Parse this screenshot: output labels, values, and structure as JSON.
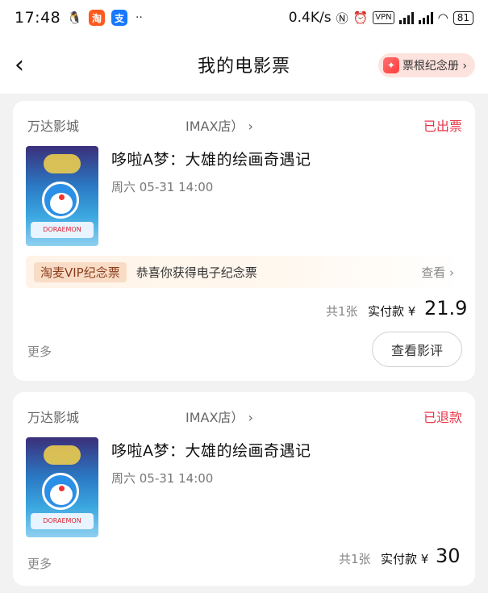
{
  "statusbar": {
    "time": "17:48",
    "speed": "0.4K/s",
    "vpn": "VPN",
    "battery": "81",
    "dots": "··"
  },
  "nav": {
    "title": "我的电影票",
    "stub_button": "票根纪念册 ›"
  },
  "tickets": [
    {
      "cinema": "万达影城",
      "branch": "IMAX店）  ›",
      "status": "已出票",
      "movie": "哆啦A梦：大雄的绘画奇遇记",
      "showtime": "周六 05-31 14:00",
      "vip_tag": "淘麦VIP纪念票",
      "vip_message": "恭喜你获得电子纪念票",
      "vip_view": "查看 ›",
      "count": "共1张",
      "pay_label": "实付款 ¥",
      "price": "21.9",
      "more": "更多",
      "review_button": "查看影评"
    },
    {
      "cinema": "万达影城",
      "branch": "IMAX店）  ›",
      "status": "已退款",
      "movie": "哆啦A梦：大雄的绘画奇遇记",
      "showtime": "周六 05-31 14:00",
      "count": "共1张",
      "pay_label": "实付款 ¥",
      "price": "30",
      "more": "更多"
    }
  ],
  "colors": {
    "status_red": "#e8374a",
    "background": "#f2f2f2"
  }
}
